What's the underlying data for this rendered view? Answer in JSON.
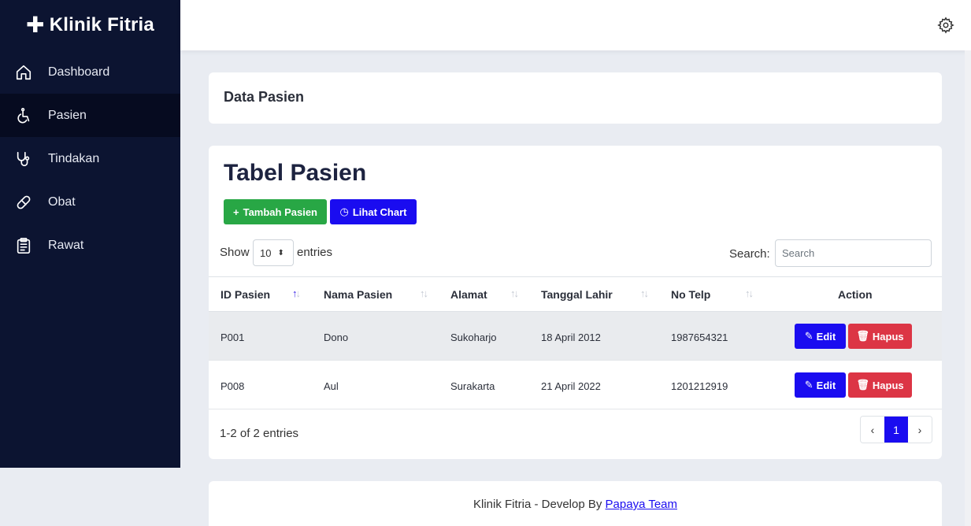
{
  "brand": {
    "name": "Klinik Fitria"
  },
  "sidebar": {
    "items": [
      {
        "label": "Dashboard",
        "icon": "home-icon",
        "active": false
      },
      {
        "label": "Pasien",
        "icon": "wheelchair-icon",
        "active": true
      },
      {
        "label": "Tindakan",
        "icon": "stethoscope-icon",
        "active": false
      },
      {
        "label": "Obat",
        "icon": "pill-icon",
        "active": false
      },
      {
        "label": "Rawat",
        "icon": "clipboard-icon",
        "active": false
      }
    ]
  },
  "topbar": {
    "icon": "gear-icon"
  },
  "header": {
    "title": "Data Pasien"
  },
  "table_card": {
    "title": "Tabel Pasien",
    "add_button": "Tambah Pasien",
    "chart_button": "Lihat Chart",
    "show_label": "Show",
    "page_size": "10",
    "entries_label": "entries",
    "search_label": "Search:",
    "search_placeholder": "Search",
    "columns": [
      "ID Pasien",
      "Nama Pasien",
      "Alamat",
      "Tanggal Lahir",
      "No Telp",
      "Action"
    ],
    "rows": [
      {
        "id": "P001",
        "nama": "Dono",
        "alamat": "Sukoharjo",
        "tgl": "18 April 2012",
        "telp": "1987654321"
      },
      {
        "id": "P008",
        "nama": "Aul",
        "alamat": "Surakarta",
        "tgl": "21 April 2022",
        "telp": "1201212919"
      }
    ],
    "edit_label": "Edit",
    "delete_label": "Hapus",
    "info": "1-2 of 2 entries",
    "pagination": {
      "prev": "‹",
      "current": "1",
      "next": "›"
    }
  },
  "footer": {
    "text": "Klinik Fitria - Develop By ",
    "link": "Papaya Team"
  },
  "colors": {
    "sidebar": "#0c1431",
    "primary": "#1a0cf0",
    "success": "#28a745",
    "danger": "#dc3545"
  }
}
